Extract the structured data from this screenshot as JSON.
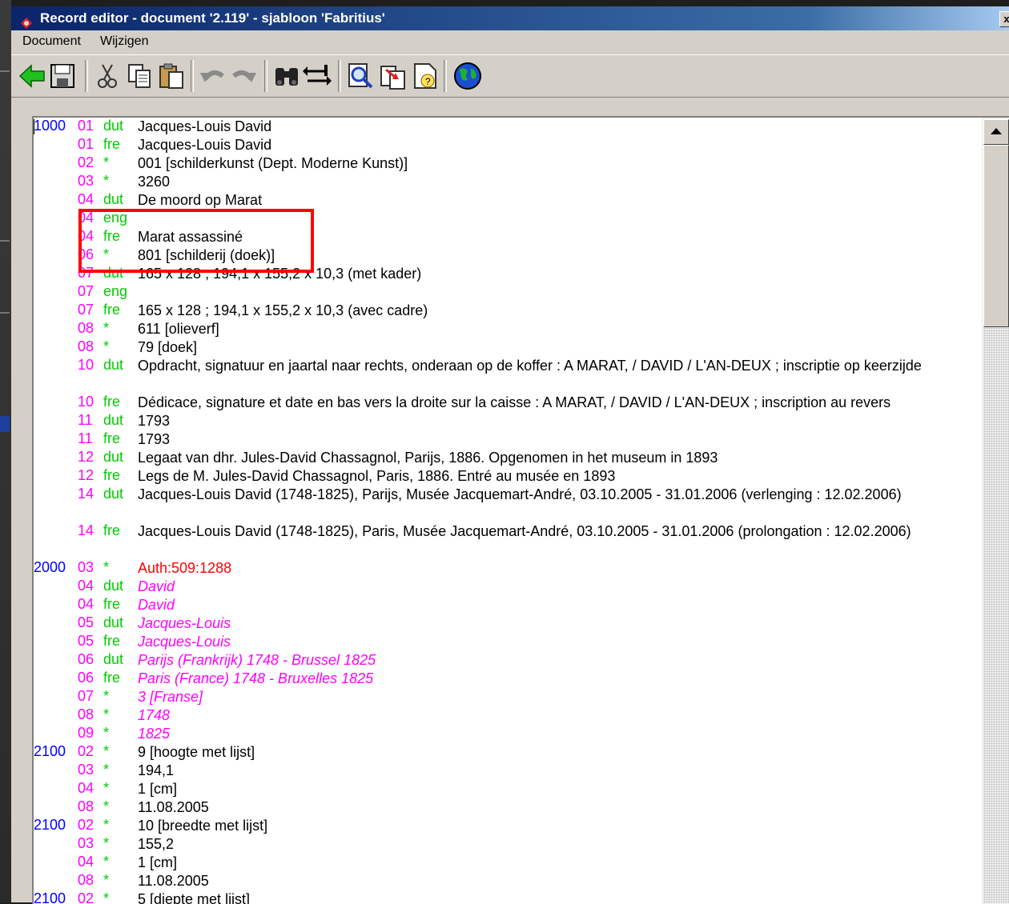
{
  "window": {
    "title": "Record editor - document '2.119' - sjabloon 'Fabritius'",
    "close_label": "x"
  },
  "menu": [
    "Document",
    "Wijzigen"
  ],
  "toolbar": {
    "icons": [
      "back-arrow-icon",
      "save-icon",
      "cut-icon",
      "copy-icon",
      "paste-icon",
      "undo-icon",
      "redo-icon",
      "find-icon",
      "replace-icon",
      "preview-icon",
      "copy-record-icon",
      "help-document-icon",
      "globe-icon"
    ]
  },
  "records": [
    {
      "tag": "1000",
      "sub": "01",
      "lang": "dut",
      "value": "Jacques-Louis David"
    },
    {
      "tag": "",
      "sub": "01",
      "lang": "fre",
      "value": "Jacques-Louis David"
    },
    {
      "tag": "",
      "sub": "02",
      "lang": "*",
      "value": "001 [schilderkunst (Dept. Moderne Kunst)]"
    },
    {
      "tag": "",
      "sub": "03",
      "lang": "*",
      "value": "3260"
    },
    {
      "tag": "",
      "sub": "04",
      "lang": "dut",
      "value": "De moord op Marat"
    },
    {
      "tag": "",
      "sub": "04",
      "lang": "eng",
      "value": ""
    },
    {
      "tag": "",
      "sub": "04",
      "lang": "fre",
      "value": "Marat assassiné"
    },
    {
      "tag": "",
      "sub": "06",
      "lang": "*",
      "value": "801 [schilderij (doek)]"
    },
    {
      "tag": "",
      "sub": "07",
      "lang": "dut",
      "value": "165 x 128 ; 194,1 x 155,2 x 10,3 (met kader)"
    },
    {
      "tag": "",
      "sub": "07",
      "lang": "eng",
      "value": ""
    },
    {
      "tag": "",
      "sub": "07",
      "lang": "fre",
      "value": "165 x 128 ; 194,1 x 155,2 x 10,3 (avec cadre)"
    },
    {
      "tag": "",
      "sub": "08",
      "lang": "*",
      "value": "611 [olieverf]"
    },
    {
      "tag": "",
      "sub": "08",
      "lang": "*",
      "value": "79 [doek]"
    },
    {
      "tag": "",
      "sub": "10",
      "lang": "dut",
      "value": "Opdracht, signatuur en jaartal naar rechts, onderaan op de koffer : A MARAT, / DAVID / L'AN-DEUX ; inscriptie op keerzijde",
      "wrap": true
    },
    {
      "tag": "",
      "sub": "10",
      "lang": "fre",
      "value": "Dédicace, signature et date en bas vers la droite sur la caisse : A MARAT, / DAVID / L'AN-DEUX ; inscription au revers"
    },
    {
      "tag": "",
      "sub": "11",
      "lang": "dut",
      "value": "1793"
    },
    {
      "tag": "",
      "sub": "11",
      "lang": "fre",
      "value": "1793"
    },
    {
      "tag": "",
      "sub": "12",
      "lang": "dut",
      "value": "Legaat van dhr. Jules-David Chassagnol, Parijs, 1886. Opgenomen in het museum in 1893"
    },
    {
      "tag": "",
      "sub": "12",
      "lang": "fre",
      "value": "Legs de M. Jules-David Chassagnol, Paris, 1886. Entré au musée en 1893"
    },
    {
      "tag": "",
      "sub": "14",
      "lang": "dut",
      "value": "Jacques-Louis David (1748-1825), Parijs, Musée Jacquemart-André, 03.10.2005 - 31.01.2006 (verlenging : 12.02.2006)",
      "wrap": true
    },
    {
      "tag": "",
      "sub": "14",
      "lang": "fre",
      "value": "Jacques-Louis David (1748-1825), Paris, Musée Jacquemart-André, 03.10.2005 - 31.01.2006 (prolongation : 12.02.2006)",
      "wrap": true
    },
    {
      "tag": "2000",
      "sub": "03",
      "lang": "*",
      "value": "Auth:509:1288",
      "style": "link"
    },
    {
      "tag": "",
      "sub": "04",
      "lang": "dut",
      "value": "David",
      "style": "auth"
    },
    {
      "tag": "",
      "sub": "04",
      "lang": "fre",
      "value": "David",
      "style": "auth"
    },
    {
      "tag": "",
      "sub": "05",
      "lang": "dut",
      "value": "Jacques-Louis",
      "style": "auth"
    },
    {
      "tag": "",
      "sub": "05",
      "lang": "fre",
      "value": "Jacques-Louis",
      "style": "auth"
    },
    {
      "tag": "",
      "sub": "06",
      "lang": "dut",
      "value": "Parijs (Frankrijk) 1748 - Brussel 1825",
      "style": "auth"
    },
    {
      "tag": "",
      "sub": "06",
      "lang": "fre",
      "value": "Paris (France) 1748 - Bruxelles 1825",
      "style": "auth"
    },
    {
      "tag": "",
      "sub": "07",
      "lang": "*",
      "value": "3 [Franse]",
      "style": "auth"
    },
    {
      "tag": "",
      "sub": "08",
      "lang": "*",
      "value": "1748",
      "style": "auth"
    },
    {
      "tag": "",
      "sub": "09",
      "lang": "*",
      "value": "1825",
      "style": "auth"
    },
    {
      "tag": "2100",
      "sub": "02",
      "lang": "*",
      "value": "9 [hoogte met lijst]"
    },
    {
      "tag": "",
      "sub": "03",
      "lang": "*",
      "value": "194,1"
    },
    {
      "tag": "",
      "sub": "04",
      "lang": "*",
      "value": "1 [cm]"
    },
    {
      "tag": "",
      "sub": "08",
      "lang": "*",
      "value": "11.08.2005"
    },
    {
      "tag": "2100",
      "sub": "02",
      "lang": "*",
      "value": "10 [breedte met lijst]"
    },
    {
      "tag": "",
      "sub": "03",
      "lang": "*",
      "value": "155,2"
    },
    {
      "tag": "",
      "sub": "04",
      "lang": "*",
      "value": "1 [cm]"
    },
    {
      "tag": "",
      "sub": "08",
      "lang": "*",
      "value": "11.08.2005"
    },
    {
      "tag": "2100",
      "sub": "02",
      "lang": "*",
      "value": "5 [diepte met lijst]"
    }
  ]
}
